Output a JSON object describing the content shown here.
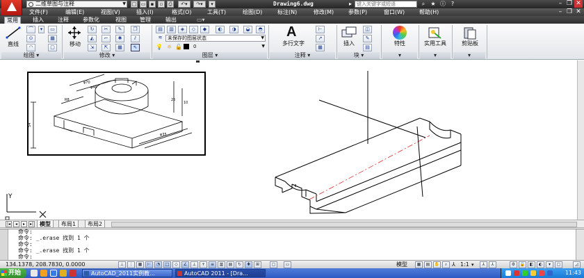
{
  "title_bar": {
    "workspace": "二维草图与注释",
    "document_title": "Drawing6.dwg",
    "help_search_placeholder": "键入关键字或短语"
  },
  "menu": [
    "文件(F)",
    "编辑(E)",
    "视图(V)",
    "插入(I)",
    "格式(O)",
    "工具(T)",
    "绘图(D)",
    "标注(N)",
    "修改(M)",
    "参数(P)",
    "窗口(W)",
    "帮助(H)"
  ],
  "ribbon_tabs": [
    "常用",
    "插入",
    "注释",
    "参数化",
    "视图",
    "管理",
    "输出"
  ],
  "ribbon": {
    "draw": {
      "title": "绘图",
      "line_label": "直线"
    },
    "modify": {
      "title": "修改",
      "move_label": "移动"
    },
    "layers": {
      "title": "图层",
      "layer_state": "未保存的图层状态",
      "current_layer": "0"
    },
    "annotation": {
      "title": "注释",
      "mtext_label": "多行文字"
    },
    "block": {
      "title": "块",
      "insert_label": "插入"
    },
    "properties_label": "特性",
    "utilities_label": "实用工具",
    "clipboard_label": "剪贴板"
  },
  "ucs": {
    "y_label": "Y"
  },
  "layout_tabs": [
    "模型",
    "布局1",
    "布局2"
  ],
  "command_lines": [
    "命令:",
    "命令: _.erase 找到 1 个",
    "命令:",
    "命令: _.erase 找到 1 个",
    "命令:"
  ],
  "status": {
    "coords": "134.1378, 208.7830, 0.0000",
    "space": "模型",
    "annotation_scale": "1:1"
  },
  "taskbar": {
    "start_label": "开始",
    "tasks": [
      "AutoCAD_2011实例教...",
      "AutoCAD 2011 - [Dra..."
    ],
    "clock": "11:43"
  },
  "colors": {
    "accent": "#2d5ac4",
    "cad_red": "#d02010",
    "center_line": "#e03030"
  }
}
